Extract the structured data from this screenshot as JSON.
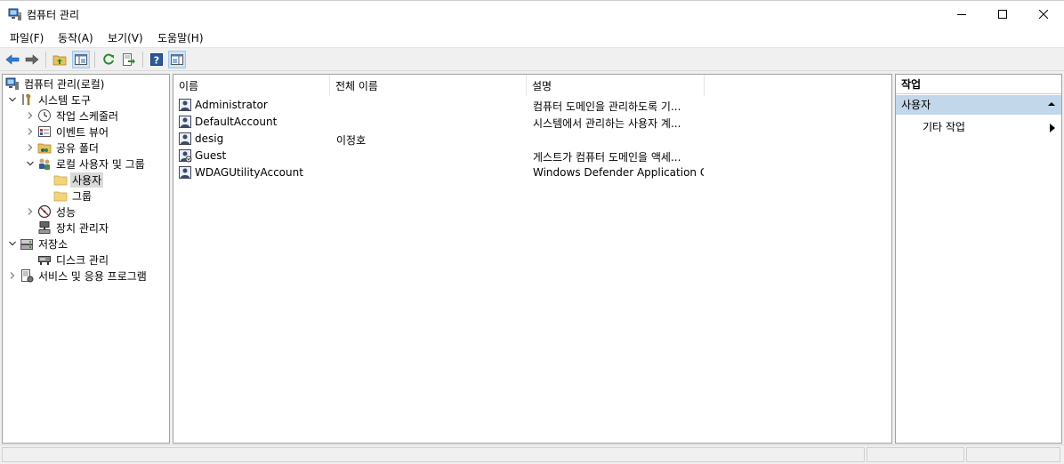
{
  "window": {
    "title": "컴퓨터 관리"
  },
  "menu": {
    "items": [
      "파일(F)",
      "동작(A)",
      "보기(V)",
      "도움말(H)"
    ]
  },
  "toolbar": {
    "buttons": [
      "back-icon",
      "forward-icon",
      "up-folder-icon",
      "show-hide-tree-icon",
      "refresh-icon",
      "export-icon",
      "help-icon",
      "show-hide-action-icon"
    ]
  },
  "tree": {
    "root": "컴퓨터 관리(로컬)",
    "system_tools": "시스템 도구",
    "task_scheduler": "작업 스케줄러",
    "event_viewer": "이벤트 뷰어",
    "shared_folders": "공유 폴더",
    "local_users_groups": "로컬 사용자 및 그룹",
    "users": "사용자",
    "groups": "그룹",
    "performance": "성능",
    "device_manager": "장치 관리자",
    "storage": "저장소",
    "disk_management": "디스크 관리",
    "services_apps": "서비스 및 응용 프로그램"
  },
  "list": {
    "columns": [
      "이름",
      "전체 이름",
      "설명"
    ],
    "rows": [
      {
        "name": "Administrator",
        "full_name": "",
        "description": "컴퓨터 도메인을 관리하도록 기..."
      },
      {
        "name": "DefaultAccount",
        "full_name": "",
        "description": "시스템에서 관리하는 사용자 계..."
      },
      {
        "name": "desig",
        "full_name": "이정호",
        "description": ""
      },
      {
        "name": "Guest",
        "full_name": "",
        "description": "게스트가 컴퓨터 도메인을 액세..."
      },
      {
        "name": "WDAGUtilityAccount",
        "full_name": "",
        "description": "Windows Defender Application G..."
      }
    ]
  },
  "actions": {
    "title": "작업",
    "section": "사용자",
    "more_actions": "기타 작업"
  },
  "colors": {
    "accent_selected": "#cce4f7",
    "action_header": "#c3d7ea",
    "folder": "#e8c25b"
  }
}
